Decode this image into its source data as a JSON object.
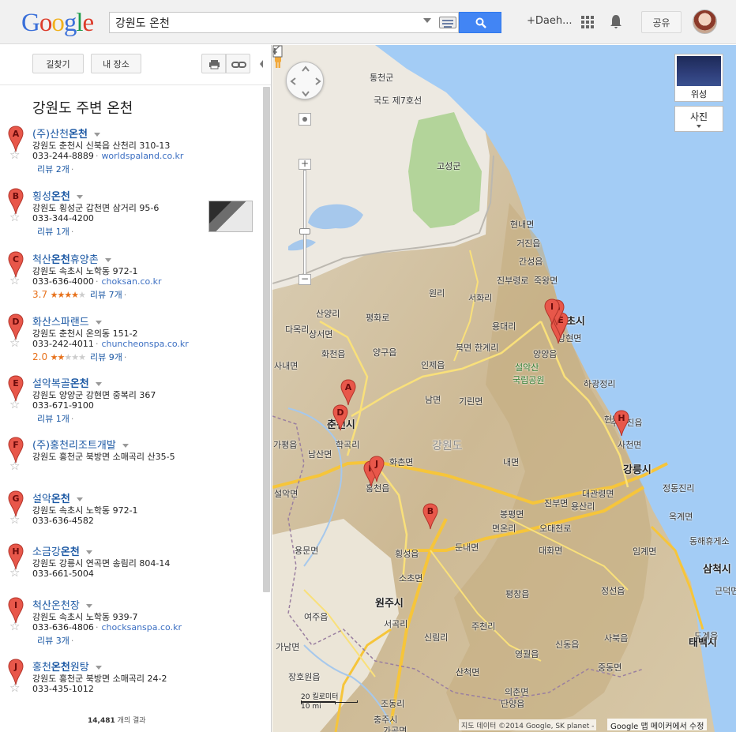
{
  "header": {
    "logo_letters": [
      "G",
      "o",
      "o",
      "g",
      "l",
      "e"
    ],
    "logo_colors": [
      "#3b70d9",
      "#dc3c2b",
      "#f1b11c",
      "#3b70d9",
      "#1d9c4b",
      "#dc3c2b"
    ],
    "search_value": "강원도 온천",
    "user_name": "+Daeh...",
    "share_label": "공유"
  },
  "panel": {
    "directions_label": "길찾기",
    "my_places_label": "내 장소",
    "title": "강원도 주변 온천",
    "result_count": "14,481",
    "result_count_suffix": " 개의 결과",
    "results": [
      {
        "letter": "A",
        "name_pre": "(주)산천",
        "name_bold": "온천",
        "name_post": "",
        "address": "강원도 춘천시 신북읍 산천리 310-13",
        "phone": "033-244-8889",
        "url": "worldspaland.co.kr",
        "extra": "리뷰 2개",
        "rating": "",
        "stars": 0
      },
      {
        "letter": "B",
        "name_pre": "횡성",
        "name_bold": "온천",
        "name_post": "",
        "address": "강원도 횡성군 갑천면 삼거리 95-6",
        "phone": "033-344-4200",
        "url": "",
        "extra": "리뷰 1개",
        "rating": "",
        "stars": 0,
        "thumb": true
      },
      {
        "letter": "C",
        "name_pre": "척산",
        "name_bold": "온천",
        "name_post": "휴양촌",
        "address": "강원도 속초시 노학동 972-1",
        "phone": "033-636-4000",
        "url": "choksan.co.kr",
        "extra": "리뷰 7개",
        "rating": "3.7",
        "stars": 3.5
      },
      {
        "letter": "D",
        "name_pre": "화산스파랜드",
        "name_bold": "",
        "name_post": "",
        "address": "강원도 춘천시 온의동 151-2",
        "phone": "033-242-4011",
        "url": "chuncheonspa.co.kr",
        "extra": "리뷰 9개",
        "rating": "2.0",
        "stars": 2
      },
      {
        "letter": "E",
        "name_pre": "설악복골",
        "name_bold": "온천",
        "name_post": "",
        "address": "강원도 양양군 강현면 중복리 367",
        "phone": "033-671-9100",
        "url": "",
        "extra": "리뷰 1개",
        "rating": "",
        "stars": 0
      },
      {
        "letter": "F",
        "name_pre": "(주)홍천리조트개발",
        "name_bold": "",
        "name_post": "",
        "address": "강원도 홍천군 북방면 소매곡리 산35-5",
        "phone": "",
        "url": "",
        "extra": "",
        "rating": "",
        "stars": 0
      },
      {
        "letter": "G",
        "name_pre": "설악",
        "name_bold": "온천",
        "name_post": "",
        "address": "강원도 속초시 노학동 972-1",
        "phone": "033-636-4582",
        "url": "",
        "extra": "",
        "rating": "",
        "stars": 0
      },
      {
        "letter": "H",
        "name_pre": "소금강",
        "name_bold": "온천",
        "name_post": "",
        "address": "강원도 강릉시 연곡면 송림리 804-14",
        "phone": "033-661-5004",
        "url": "",
        "extra": "",
        "rating": "",
        "stars": 0
      },
      {
        "letter": "I",
        "name_pre": "척산온천장",
        "name_bold": "",
        "name_post": "",
        "address": "강원도 속초시 노학동 939-7",
        "phone": "033-636-4806",
        "url": "chocksanspa.co.kr",
        "extra": "리뷰 3개",
        "rating": "",
        "stars": 0
      },
      {
        "letter": "J",
        "name_pre": "홍천",
        "name_bold": "온천",
        "name_post": "원탕",
        "address": "강원도 홍천군 북방면 소매곡리 24-2",
        "phone": "033-435-1012",
        "url": "",
        "extra": "",
        "rating": "",
        "stars": 0
      }
    ]
  },
  "map": {
    "satellite_label": "위성",
    "photo_label": "사진",
    "scale_km": "20 킬로미터",
    "scale_mi": "10 mi",
    "attribution": "지도 데이터 ©2014 Google, SK planet -",
    "report_label": "Google 맵 메이커에서 수정",
    "labels": [
      {
        "t": "통천군",
        "c": ""
      },
      {
        "t": "국도 제7호선",
        "c": ""
      },
      {
        "t": "고성군",
        "c": ""
      },
      {
        "t": "현내면",
        "c": ""
      },
      {
        "t": "거진읍",
        "c": ""
      },
      {
        "t": "간성읍",
        "c": ""
      },
      {
        "t": "진부령로",
        "c": ""
      },
      {
        "t": "죽왕면",
        "c": ""
      },
      {
        "t": "서화리",
        "c": ""
      },
      {
        "t": "원리",
        "c": ""
      },
      {
        "t": "산양리",
        "c": ""
      },
      {
        "t": "평화로",
        "c": ""
      },
      {
        "t": "다목리",
        "c": ""
      },
      {
        "t": "상서면",
        "c": ""
      },
      {
        "t": "용대리",
        "c": ""
      },
      {
        "t": "속초시",
        "c": "big"
      },
      {
        "t": "강현면",
        "c": ""
      },
      {
        "t": "화천읍",
        "c": ""
      },
      {
        "t": "양구읍",
        "c": ""
      },
      {
        "t": "북면",
        "c": ""
      },
      {
        "t": "한계리",
        "c": ""
      },
      {
        "t": "양양읍",
        "c": ""
      },
      {
        "t": "사내면",
        "c": ""
      },
      {
        "t": "인제읍",
        "c": ""
      },
      {
        "t": "설악산",
        "c": "park"
      },
      {
        "t": "국립공원",
        "c": "park"
      },
      {
        "t": "하광정리",
        "c": ""
      },
      {
        "t": "남면",
        "c": ""
      },
      {
        "t": "기린면",
        "c": ""
      },
      {
        "t": "현남면",
        "c": ""
      },
      {
        "t": "춘천시",
        "c": "big"
      },
      {
        "t": "가평읍",
        "c": ""
      },
      {
        "t": "남산면",
        "c": ""
      },
      {
        "t": "학곡리",
        "c": ""
      },
      {
        "t": "강원도",
        "c": "region"
      },
      {
        "t": "주문진읍",
        "c": ""
      },
      {
        "t": "사천면",
        "c": ""
      },
      {
        "t": "화촌면",
        "c": ""
      },
      {
        "t": "내면",
        "c": ""
      },
      {
        "t": "강릉시",
        "c": "big"
      },
      {
        "t": "홍천읍",
        "c": ""
      },
      {
        "t": "설악면",
        "c": ""
      },
      {
        "t": "대관령면",
        "c": ""
      },
      {
        "t": "진부면",
        "c": ""
      },
      {
        "t": "용산리",
        "c": ""
      },
      {
        "t": "정동진리",
        "c": ""
      },
      {
        "t": "봉평면",
        "c": ""
      },
      {
        "t": "면온리",
        "c": ""
      },
      {
        "t": "오대천로",
        "c": ""
      },
      {
        "t": "옥계면",
        "c": ""
      },
      {
        "t": "동해휴게소",
        "c": ""
      },
      {
        "t": "용문면",
        "c": ""
      },
      {
        "t": "횡성읍",
        "c": ""
      },
      {
        "t": "둔내면",
        "c": ""
      },
      {
        "t": "대화면",
        "c": ""
      },
      {
        "t": "임계면",
        "c": ""
      },
      {
        "t": "삼척시",
        "c": "big"
      },
      {
        "t": "소초면",
        "c": ""
      },
      {
        "t": "원주시",
        "c": "big"
      },
      {
        "t": "평창읍",
        "c": ""
      },
      {
        "t": "정선읍",
        "c": ""
      },
      {
        "t": "근덕면",
        "c": ""
      },
      {
        "t": "여주읍",
        "c": ""
      },
      {
        "t": "서곡리",
        "c": ""
      },
      {
        "t": "주천리",
        "c": ""
      },
      {
        "t": "사북읍",
        "c": ""
      },
      {
        "t": "도계읍",
        "c": ""
      },
      {
        "t": "가남면",
        "c": ""
      },
      {
        "t": "신림리",
        "c": ""
      },
      {
        "t": "영월읍",
        "c": ""
      },
      {
        "t": "신동읍",
        "c": ""
      },
      {
        "t": "태백시",
        "c": "big"
      },
      {
        "t": "장호원읍",
        "c": ""
      },
      {
        "t": "산척면",
        "c": ""
      },
      {
        "t": "중동면",
        "c": ""
      },
      {
        "t": "의춘면",
        "c": ""
      },
      {
        "t": "조동리",
        "c": ""
      },
      {
        "t": "단양읍",
        "c": ""
      },
      {
        "t": "충주시",
        "c": ""
      },
      {
        "t": "가곡면",
        "c": ""
      }
    ]
  }
}
